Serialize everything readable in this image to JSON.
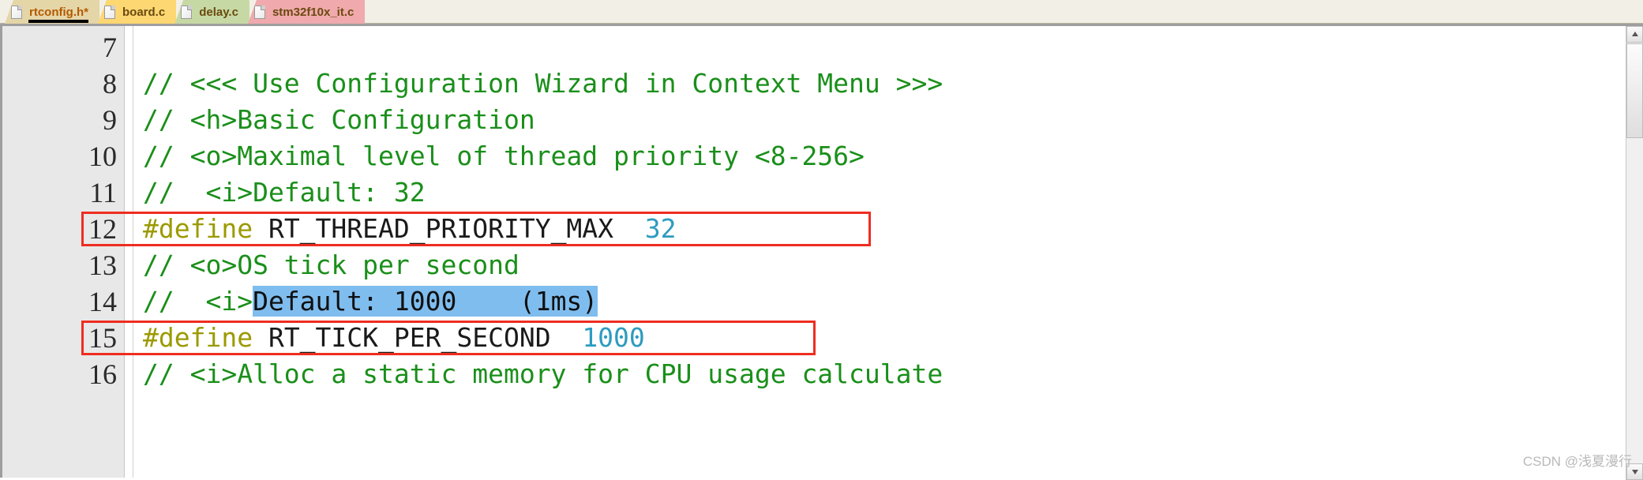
{
  "tabbar": {
    "tabs": [
      {
        "label": "rtconfig.h*",
        "icon": "file-page-icon",
        "color": "#e5d6a8",
        "active": true
      },
      {
        "label": "board.c",
        "icon": "file-page-icon",
        "color": "#fcd772",
        "active": false
      },
      {
        "label": "delay.c",
        "icon": "file-page-icon",
        "color": "#c6d9a4",
        "active": false
      },
      {
        "label": "stm32f10x_it.c",
        "icon": "file-page-icon",
        "color": "#f0a9ac",
        "active": false
      }
    ]
  },
  "editor": {
    "gutter_numbers": [
      "7",
      "8",
      "9",
      "10",
      "11",
      "12",
      "13",
      "14",
      "15",
      "16"
    ],
    "lines": [
      {
        "number": "7",
        "tokens": []
      },
      {
        "number": "8",
        "tokens": [
          {
            "text": "// <<< Use Configuration Wizard in Context Menu >>>",
            "type": "comment"
          }
        ]
      },
      {
        "number": "9",
        "tokens": [
          {
            "text": "// <h>Basic Configuration",
            "type": "comment"
          }
        ]
      },
      {
        "number": "10",
        "tokens": [
          {
            "text": "// <o>Maximal level of thread priority <8-256>",
            "type": "comment"
          }
        ]
      },
      {
        "number": "11",
        "tokens": [
          {
            "text": "//  <i>Default: 32",
            "type": "comment"
          }
        ]
      },
      {
        "number": "12",
        "tokens": [
          {
            "text": "#define",
            "type": "keyword"
          },
          {
            "text": " RT_THREAD_PRIORITY_MAX  ",
            "type": "ident"
          },
          {
            "text": "32",
            "type": "number"
          }
        ]
      },
      {
        "number": "13",
        "tokens": [
          {
            "text": "// <o>OS tick per second",
            "type": "comment"
          }
        ]
      },
      {
        "number": "14",
        "tokens": [
          {
            "text": "//  <i>",
            "type": "comment"
          },
          {
            "text": "Default: 1000    (1ms)",
            "type": "selected"
          }
        ]
      },
      {
        "number": "15",
        "tokens": [
          {
            "text": "#define",
            "type": "keyword"
          },
          {
            "text": " RT_TICK_PER_SECOND  ",
            "type": "ident"
          },
          {
            "text": "1000",
            "type": "number"
          }
        ]
      },
      {
        "number": "16",
        "tokens": [
          {
            "text": "// <i>Alloc a static memory for CPU usage calculate",
            "type": "comment"
          }
        ]
      }
    ],
    "annotations": [
      {
        "name": "redbox-priority-max",
        "line": "12",
        "color": "#ee2d20"
      },
      {
        "name": "redbox-tick-per-second",
        "line": "15",
        "color": "#ee2d20"
      }
    ],
    "selection": {
      "text": "Default: 1000    (1ms)",
      "color": "#7fbdef",
      "line": "14"
    }
  },
  "scrollbar": {
    "up_arrow": "▲",
    "down_arrow": "▼"
  },
  "watermark": {
    "text": "CSDN @浅夏漫行"
  }
}
